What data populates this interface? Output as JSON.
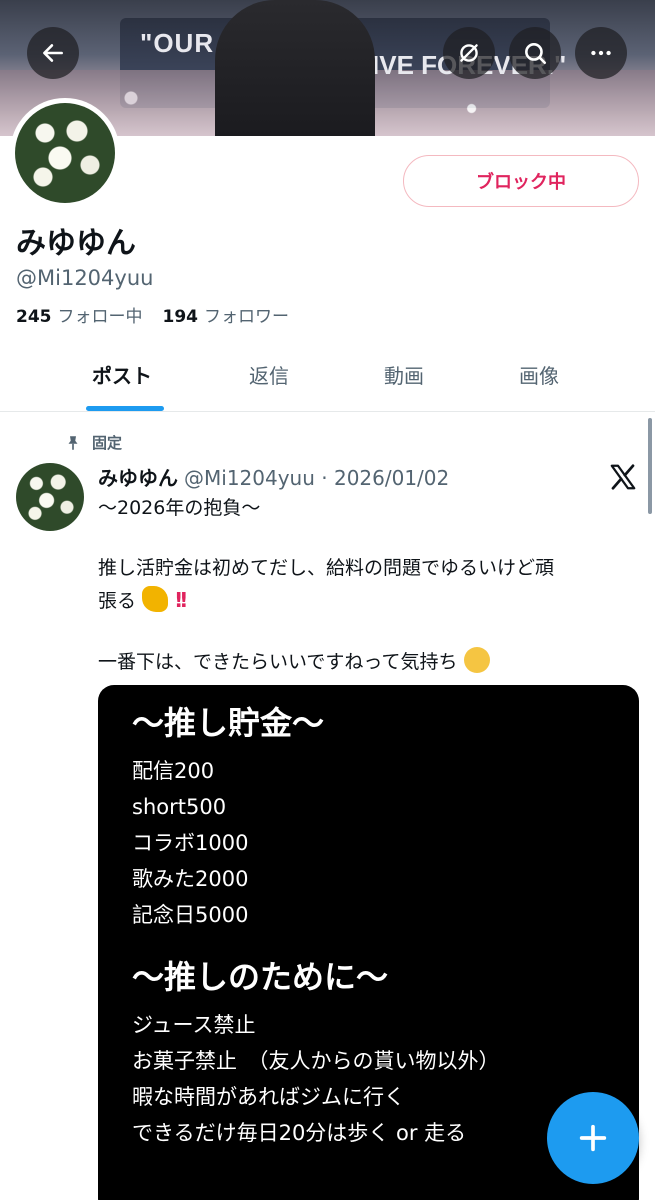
{
  "header": {
    "banner_text_left": "\"OUR C",
    "banner_text_right": "IVE FOREVER.\""
  },
  "profile": {
    "display_name": "みゆゆん",
    "handle": "@Mi1204yuu",
    "following_count": "245",
    "following_label": "フォロー中",
    "followers_count": "194",
    "followers_label": "フォロワー",
    "block_button": "ブロック中"
  },
  "tabs": [
    {
      "label": "ポスト",
      "active": true
    },
    {
      "label": "返信",
      "active": false
    },
    {
      "label": "動画",
      "active": false
    },
    {
      "label": "画像",
      "active": false
    }
  ],
  "post": {
    "pinned_label": "固定",
    "author": "みゆゆん",
    "handle_date": "@Mi1204yuu · 2026/01/02",
    "line1": "〜2026年の抱負〜",
    "line2": "推し活貯金は初めてだし、給料の問題でゆるいけど頑",
    "line3": "張る",
    "line4": "一番下は、できたらいいですねって気持ち",
    "media": {
      "heading1": "〜推し貯金〜",
      "items1": [
        "配信200",
        "short500",
        "コラボ1000",
        "歌みた2000",
        "記念日5000"
      ],
      "heading2": "〜推しのために〜",
      "items2": [
        "ジュース禁止",
        "お菓子禁止　（友人からの貰い物以外）",
        "暇な時間があればジムに行く",
        "できるだけ毎日20分は歩く or 走る"
      ]
    }
  },
  "icons": {
    "back": "arrow-left-icon",
    "discover": "grok-icon",
    "search": "search-icon",
    "more": "more-icon",
    "pin": "pin-icon",
    "x_logo": "x-logo-icon",
    "compose": "plus-icon"
  },
  "colors": {
    "accent": "#1d9bf0",
    "block_red": "#e0245e",
    "secondary_text": "#536471"
  }
}
